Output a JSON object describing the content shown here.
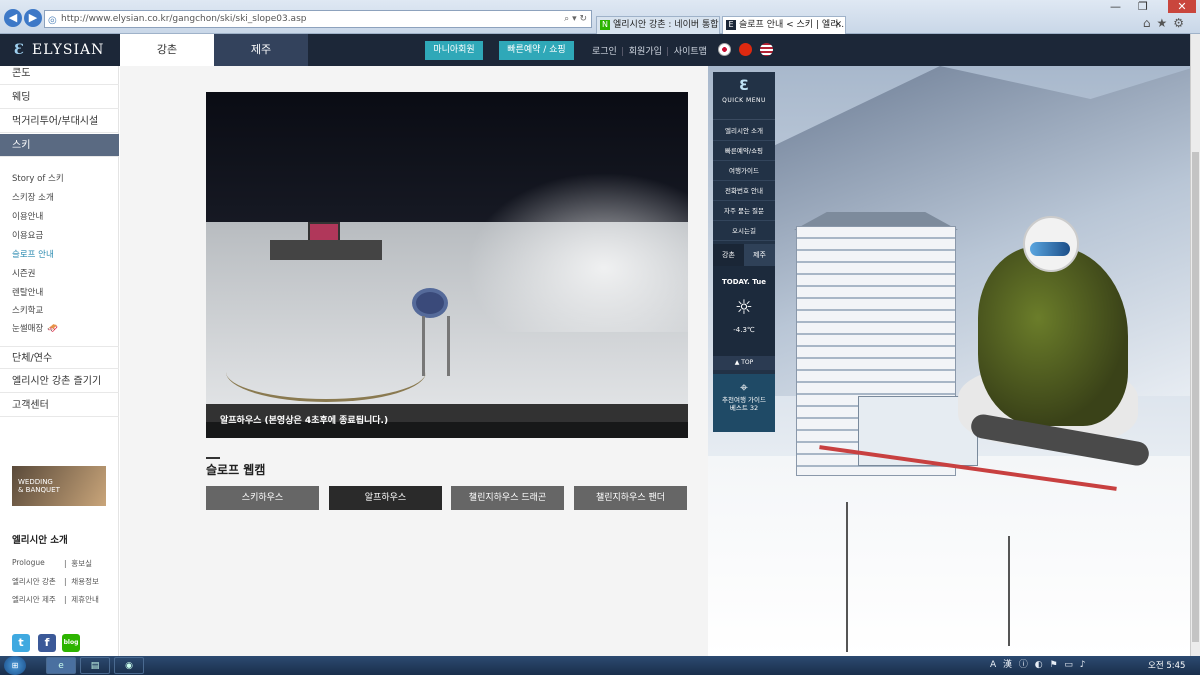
{
  "browser": {
    "url": "http://www.elysian.co.kr/gangchon/ski/ski_slope03.asp",
    "tabs": [
      {
        "label": "엘리시안 강촌 : 네이버 통합검...",
        "active": false
      },
      {
        "label": "슬로프 안내 < 스키 | 엘리...",
        "active": true
      }
    ]
  },
  "header": {
    "logo": "ELYSIAN",
    "region_tabs": [
      "강촌",
      "제주"
    ],
    "member_button": "마니아회원",
    "reserve_button": "빠른예약 / 쇼핑",
    "links": [
      "로그인",
      "회원가입",
      "사이트맵"
    ]
  },
  "left_nav": {
    "main_items": [
      "콘도",
      "웨딩",
      "먹거리투어/부대시설",
      "스키"
    ],
    "sub_items": [
      "Story of 스키",
      "스키장 소개",
      "이용안내",
      "이용요금",
      "슬로프 안내",
      "시즌권",
      "렌탈안내",
      "스키학교",
      "눈썰매장"
    ],
    "lower_items": [
      "단체/연수",
      "엘리시안 강촌 즐기기",
      "고객센터"
    ],
    "banner_text": [
      "WEDDING",
      "& BANQUET"
    ],
    "intro_title": "엘리시안 소개",
    "intro_links": [
      "Prologue",
      "홍보실",
      "엘리시안 강촌",
      "채용정보",
      "엘리시안 제주",
      "제휴안내"
    ],
    "social": {
      "twitter": "t",
      "facebook": "f",
      "blog": "blog"
    }
  },
  "webcam": {
    "caption": "알프하우스 (본영상은 4초후에 종료됩니다.)"
  },
  "slope_cam": {
    "title": "슬로프 웹캠",
    "buttons": [
      "스키하우스",
      "알프하우스",
      "챌린지하우스 드래곤",
      "챌린지하우스 팬더"
    ],
    "active_index": 1
  },
  "quick_menu": {
    "title": "QUICK MENU",
    "items": [
      "엘리시안 소개",
      "빠른예약/쇼핑",
      "여행가이드",
      "전화번호 안내",
      "자주 묻는 질문",
      "오시는길"
    ],
    "regions": [
      "강촌",
      "제주"
    ],
    "today": "TODAY. Tue",
    "temperature": "-4.3℃",
    "top": "▲ TOP",
    "guide": [
      "추천여행 가이드",
      "베스트 32"
    ]
  },
  "taskbar": {
    "tray": "A 漢",
    "clock": "오전 5:45"
  }
}
